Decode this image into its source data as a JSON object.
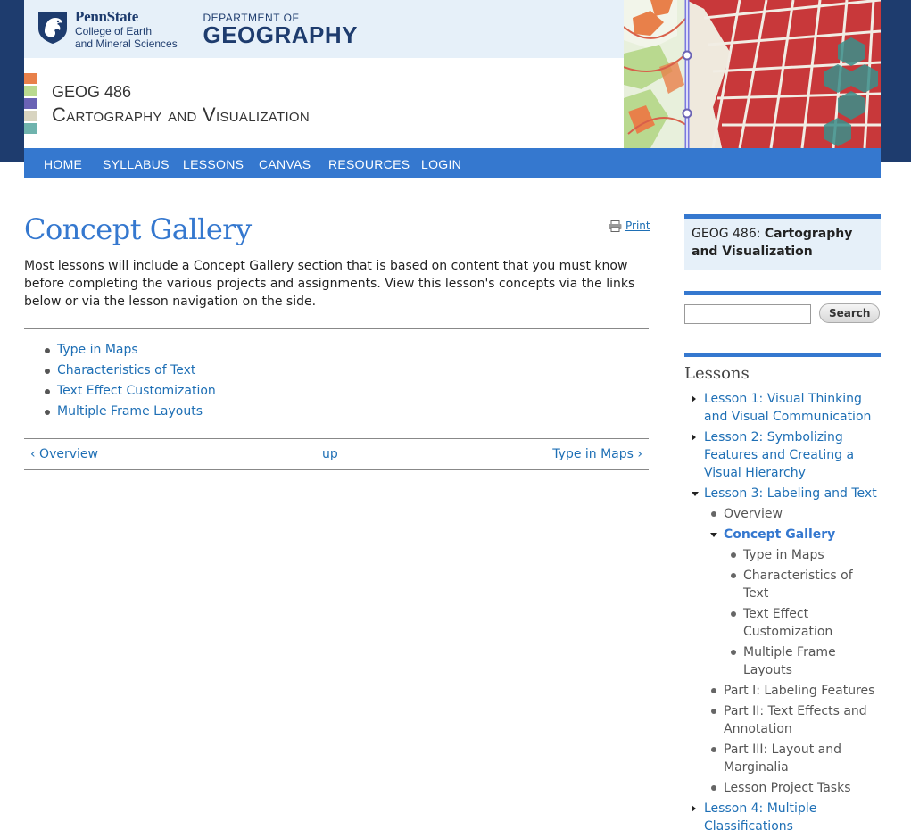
{
  "header": {
    "university": "PennState",
    "college_line1": "College of Earth",
    "college_line2": "and Mineral Sciences",
    "dept_small": "DEPARTMENT OF",
    "dept_big": "GEOGRAPHY",
    "course_code": "GEOG 486",
    "course_title": "Cartography and Visualization",
    "swatch_colors": [
      "#e8804a",
      "#b9d98f",
      "#6a63b5",
      "#d8d4c0",
      "#6fb3ad"
    ]
  },
  "nav": {
    "items": [
      "HOME",
      "SYLLABUS",
      "LESSONS",
      "CANVAS",
      "RESOURCES",
      "LOGIN"
    ]
  },
  "main": {
    "title": "Concept Gallery",
    "print_label": "Print",
    "intro": "Most lessons will include a Concept Gallery section that is based on content that you must know before completing the various projects and assignments. View this lesson's concepts via the links below or via the lesson navigation on the side.",
    "concepts": [
      "Type in Maps",
      "Characteristics of Text",
      "Text Effect Customization",
      "Multiple Frame Layouts"
    ],
    "pager": {
      "prev": "‹ Overview",
      "up": "up",
      "next": "Type in Maps ›"
    }
  },
  "sidebar": {
    "course_prefix": "GEOG 486: ",
    "course_name": "Cartography and Visualization",
    "search_button": "Search",
    "search_value": "",
    "lessons_heading": "Lessons",
    "lesson1": "Lesson 1: Visual Thinking and Visual Communication",
    "lesson2": "Lesson 2: Symbolizing Features and Creating a Visual Hierarchy",
    "lesson3": "Lesson 3: Labeling and Text",
    "lesson3_items": {
      "overview": "Overview",
      "concept_gallery": "Concept Gallery",
      "gallery_children": [
        "Type in Maps",
        "Characteristics of Text",
        "Text Effect Customization",
        "Multiple Frame Layouts"
      ],
      "part1": "Part I: Labeling Features",
      "part2": "Part II: Text Effects and Annotation",
      "part3": "Part III: Layout and Marginalia",
      "tasks": "Lesson Project Tasks"
    },
    "lesson4": "Lesson 4: Multiple Classifications"
  },
  "colors": {
    "accent": "#3578cf",
    "navy": "#1e3c6e",
    "link": "#1e6fb5"
  }
}
